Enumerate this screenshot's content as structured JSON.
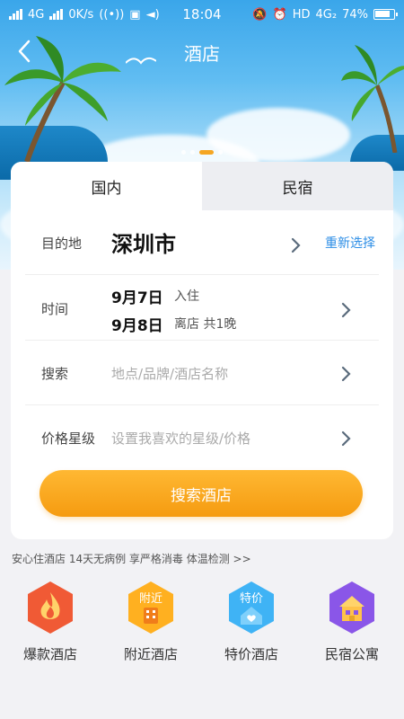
{
  "status_bar": {
    "network": "4G",
    "speed": "0K/s",
    "time": "18:04",
    "hd": "HD",
    "net2": "4G₂",
    "battery": "74%"
  },
  "nav": {
    "title": "酒店"
  },
  "tabs": [
    {
      "label": "国内",
      "active": true
    },
    {
      "label": "民宿",
      "active": false
    }
  ],
  "form": {
    "destination_label": "目的地",
    "destination_value": "深圳市",
    "reselect_label": "重新选择",
    "time_label": "时间",
    "checkin_date": "9月7日",
    "checkin_label": "入住",
    "checkout_date": "9月8日",
    "checkout_label": "离店  共1晚",
    "search_label": "搜索",
    "search_placeholder": "地点/品牌/酒店名称",
    "price_label": "价格星级",
    "price_placeholder": "设置我喜欢的星级/价格"
  },
  "search_button": "搜索酒店",
  "notice": "安心住酒店 14天无病例 享严格消毒 体温检测 >>",
  "services": [
    {
      "label": "爆款酒店",
      "icon": "flame-icon",
      "color": "#f05a35"
    },
    {
      "label": "附近酒店",
      "icon": "nearby-icon",
      "color": "#ffb020",
      "badge": "附近"
    },
    {
      "label": "特价酒店",
      "icon": "discount-icon",
      "color": "#3fb3f5",
      "badge": "特价"
    },
    {
      "label": "民宿公寓",
      "icon": "house-icon",
      "color": "#8a56e8"
    }
  ],
  "colors": {
    "accent": "#f5a623",
    "link": "#2d8ee6",
    "sky": "#3aa6ea"
  }
}
